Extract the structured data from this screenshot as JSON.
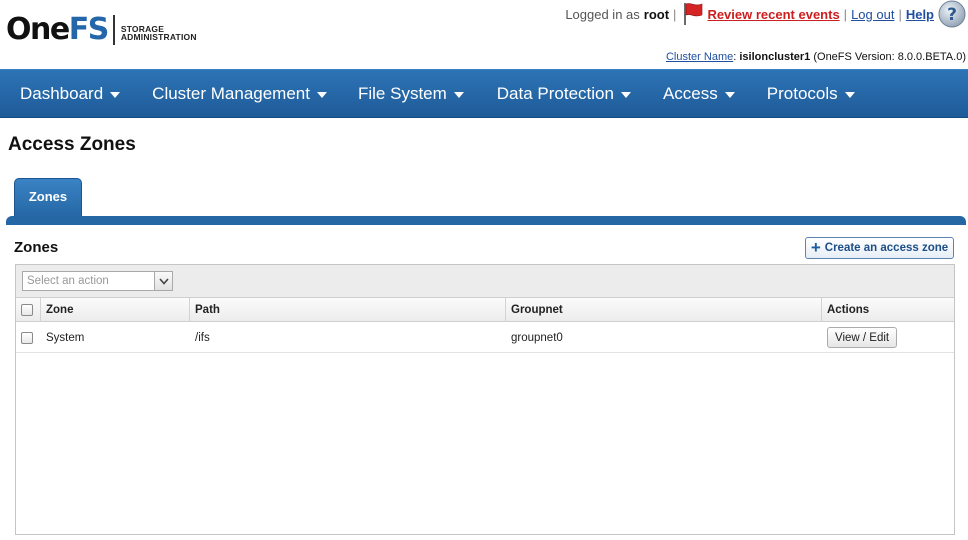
{
  "brand": {
    "name_part1": "One",
    "name_part2": "FS",
    "subtitle_line1": "STORAGE",
    "subtitle_line2": "ADMINISTRATION"
  },
  "topbar": {
    "logged_in_label": "Logged in as",
    "username": "root",
    "separator": "|",
    "events_link": "Review recent events",
    "logout_link": "Log out",
    "help_link": "Help"
  },
  "cluster": {
    "label": "Cluster Name",
    "colon": ":",
    "name": "isiloncluster1",
    "version": "(OneFS Version: 8.0.0.BETA.0)"
  },
  "nav": {
    "dashboard": "Dashboard",
    "cluster_management": "Cluster Management",
    "file_system": "File System",
    "data_protection": "Data Protection",
    "access": "Access",
    "protocols": "Protocols"
  },
  "page": {
    "title": "Access Zones",
    "tab": "Zones"
  },
  "zones_section": {
    "title": "Zones",
    "create_button": "Create an access zone",
    "action_select_placeholder": "Select an action",
    "columns": {
      "zone": "Zone",
      "path": "Path",
      "groupnet": "Groupnet",
      "actions": "Actions"
    },
    "rows": [
      {
        "zone": "System",
        "path": "/ifs",
        "groupnet": "groupnet0",
        "action_button": "View / Edit"
      }
    ]
  },
  "colors": {
    "nav_blue": "#2466aa",
    "events_red": "#cc1f1f",
    "link_blue": "#1f4fa0"
  }
}
